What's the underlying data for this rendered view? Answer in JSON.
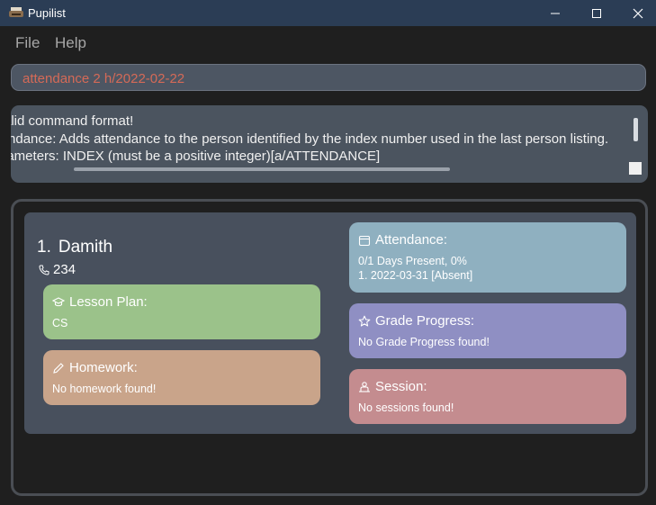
{
  "window": {
    "title": "Pupilist"
  },
  "menu": {
    "file": "File",
    "help": "Help"
  },
  "command": {
    "value": "attendance 2 h/2022-02-22"
  },
  "result": {
    "lines": [
      "Invalid command format!",
      "attendance: Adds attendance to the person identified by the index number used in the last person listing.",
      "Parameters: INDEX (must be a positive integer)[a/ATTENDANCE]"
    ]
  },
  "person": {
    "index": "1.",
    "name": "Damith",
    "phone": "234",
    "lesson_plan": {
      "title": "Lesson Plan:",
      "value": "CS"
    },
    "homework": {
      "title": "Homework:",
      "value": "No homework found!"
    },
    "attendance": {
      "title": "Attendance:",
      "summary": "0/1 Days Present, 0%",
      "record": "1. 2022-03-31 [Absent]"
    },
    "grade_progress": {
      "title": "Grade Progress:",
      "value": "No Grade Progress found!"
    },
    "session": {
      "title": "Session:",
      "value": "No sessions found!"
    }
  },
  "colors": {
    "command_text": "#d56a57",
    "lesson_plan": "#9bc28a",
    "homework": "#c9a48a",
    "attendance": "#8fb0c0",
    "grade_progress": "#8f8fc3",
    "session": "#c48c8f"
  },
  "icons": {
    "app": "typewriter-icon",
    "phone": "phone-icon",
    "lesson_plan": "graduation-cap-icon",
    "homework": "pencil-icon",
    "attendance": "calendar-icon",
    "grade_progress": "star-icon",
    "session": "person-desk-icon"
  }
}
